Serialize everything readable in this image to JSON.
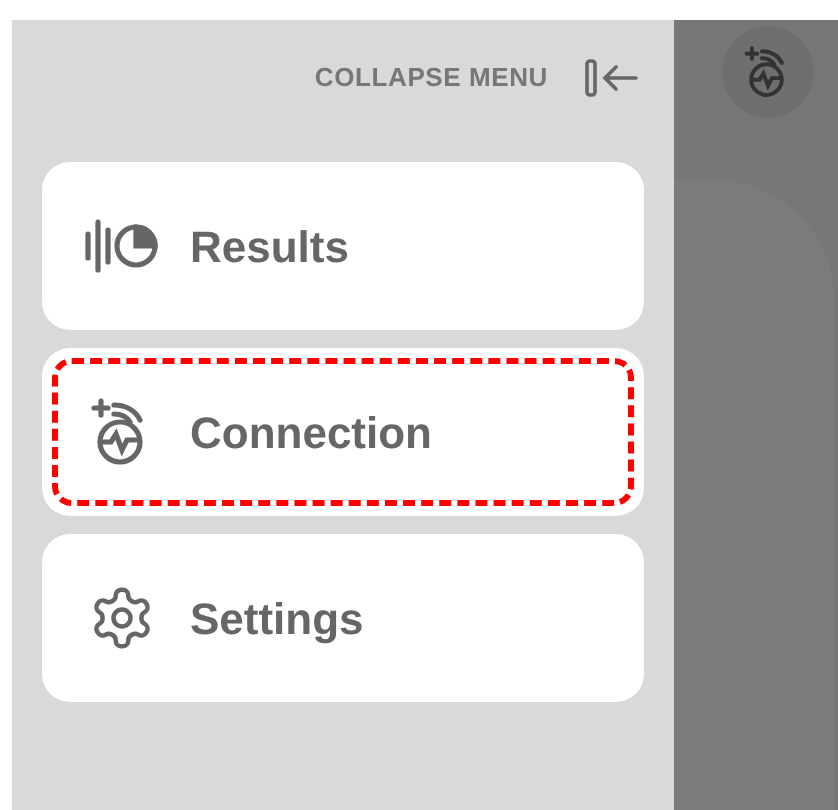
{
  "header": {
    "collapse_label": "COLLAPSE MENU"
  },
  "menu_items": [
    {
      "kind": "results",
      "label": "Results",
      "highlighted": false
    },
    {
      "kind": "connection",
      "label": "Connection",
      "highlighted": true
    },
    {
      "kind": "settings",
      "label": "Settings",
      "highlighted": false
    }
  ]
}
